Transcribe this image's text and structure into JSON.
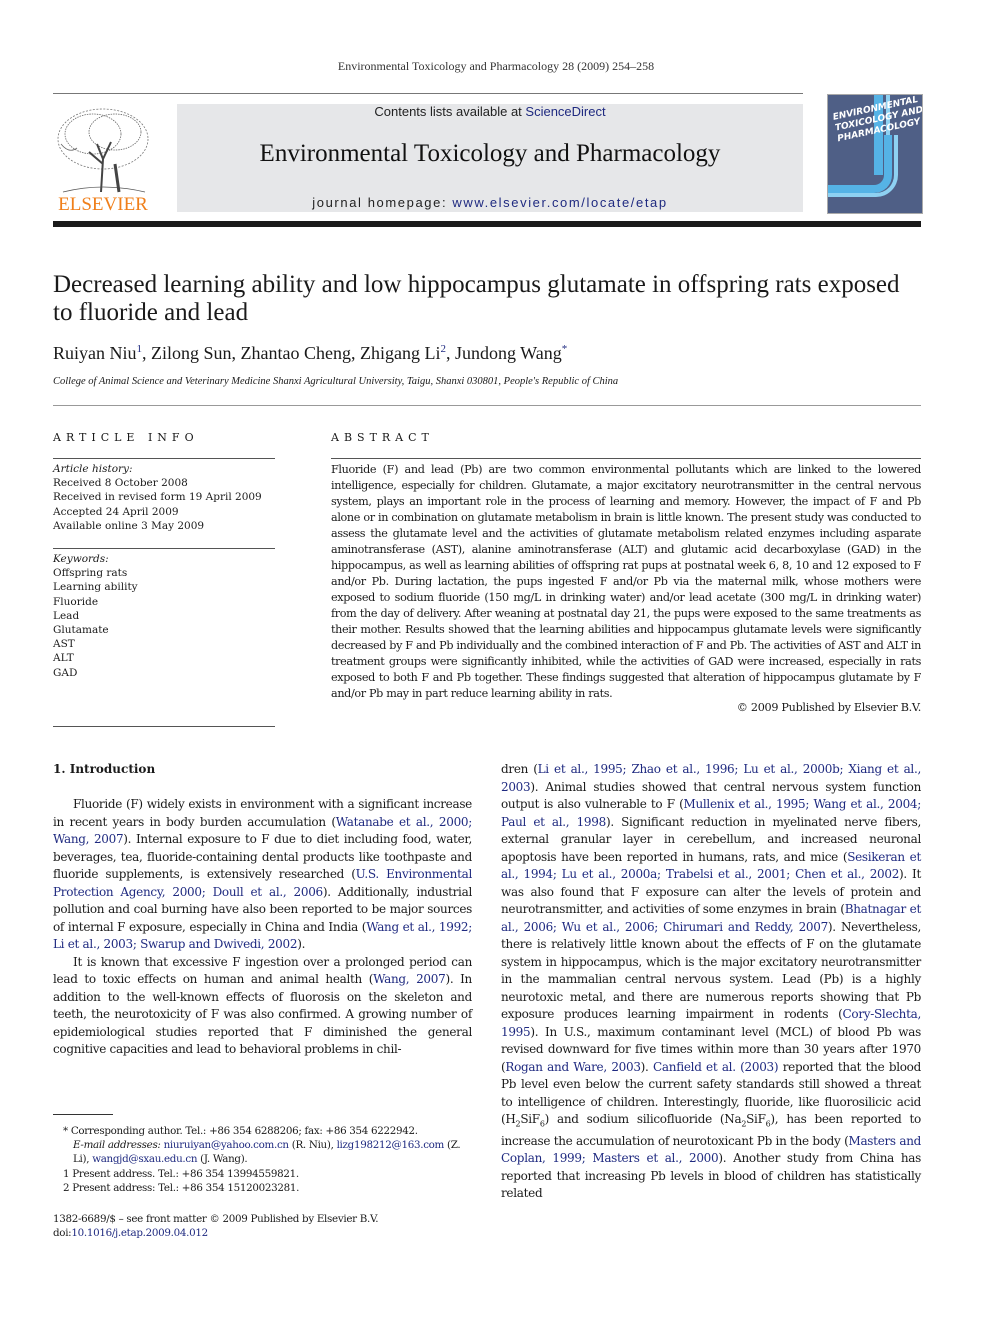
{
  "running_head": "Environmental Toxicology and Pharmacology 28 (2009) 254–258",
  "masthead": {
    "publisher_logo_text": "ELSEVIER",
    "contents_prefix": "Contents lists available at ",
    "contents_link": "ScienceDirect",
    "journal_title": "Environmental Toxicology and Pharmacology",
    "homepage_prefix": "journal homepage: ",
    "homepage_link": "www.elsevier.com/locate/etap",
    "cover_text": "ENVIRONMENTAL TOXICOLOGY AND PHARMACOLOGY",
    "colors": {
      "elsevier_orange": "#f07f1a",
      "link_blue": "#1f2a80",
      "banner_gray": "#e6e7e9",
      "cover_blue": "#4f5f86"
    }
  },
  "article": {
    "title": "Decreased learning ability and low hippocampus glutamate in offspring rats exposed to fluoride and lead",
    "authors": [
      {
        "name": "Ruiyan Niu",
        "mark": "1"
      },
      {
        "name": "Zilong Sun",
        "mark": ""
      },
      {
        "name": "Zhantao Cheng",
        "mark": ""
      },
      {
        "name": "Zhigang Li",
        "mark": "2"
      },
      {
        "name": "Jundong Wang",
        "mark": "*"
      }
    ],
    "affiliation": "College of Animal Science and Veterinary Medicine Shanxi Agricultural University, Taigu, Shanxi 030801, People's Republic of China"
  },
  "article_info": {
    "heading": "ARTICLE INFO",
    "history_label": "Article history:",
    "history": [
      "Received 8 October 2008",
      "Received in revised form 19 April 2009",
      "Accepted 24 April 2009",
      "Available online 3 May 2009"
    ],
    "keywords_label": "Keywords:",
    "keywords": [
      "Offspring rats",
      "Learning ability",
      "Fluoride",
      "Lead",
      "Glutamate",
      "AST",
      "ALT",
      "GAD"
    ]
  },
  "abstract": {
    "heading": "ABSTRACT",
    "text": "Fluoride (F) and lead (Pb) are two common environmental pollutants which are linked to the lowered intelligence, especially for children. Glutamate, a major excitatory neurotransmitter in the central nervous system, plays an important role in the process of learning and memory. However, the impact of F and Pb alone or in combination on glutamate metabolism in brain is little known. The present study was conducted to assess the glutamate level and the activities of glutamate metabolism related enzymes including asparate aminotransferase (AST), alanine aminotransferase (ALT) and glutamic acid decarboxylase (GAD) in the hippocampus, as well as learning abilities of offspring rat pups at postnatal week 6, 8, 10 and 12 exposed to F and/or Pb. During lactation, the pups ingested F and/or Pb via the maternal milk, whose mothers were exposed to sodium fluoride (150 mg/L in drinking water) and/or lead acetate (300 mg/L in drinking water) from the day of delivery. After weaning at postnatal day 21, the pups were exposed to the same treatments as their mother. Results showed that the learning abilities and hippocampus glutamate levels were significantly decreased by F and Pb individually and the combined interaction of F and Pb. The activities of AST and ALT in treatment groups were significantly inhibited, while the activities of GAD were increased, especially in rats exposed to both F and Pb together. These findings suggested that alteration of hippocampus glutamate by F and/or Pb may in part reduce learning ability in rats.",
    "copyright": "© 2009 Published by Elsevier B.V."
  },
  "introduction": {
    "heading": "1.  Introduction",
    "left_paragraphs": [
      [
        {
          "t": "Fluoride (F) widely exists in environment with a significant increase in recent years in body burden accumulation ("
        },
        {
          "l": "Watanabe et al., 2000; Wang, 2007"
        },
        {
          "t": "). Internal exposure to F due to diet including food, water, beverages, tea, fluoride-containing dental products like toothpaste and fluoride supplements, is extensively researched ("
        },
        {
          "l": "U.S. Environmental Protection Agency, 2000; Doull et al., 2006"
        },
        {
          "t": "). Additionally, industrial pollution and coal burning have also been reported to be major sources of internal F exposure, especially in China and India ("
        },
        {
          "l": "Wang et al., 1992; Li et al., 2003; Swarup and Dwivedi, 2002"
        },
        {
          "t": ")."
        }
      ],
      [
        {
          "t": "It is known that excessive F ingestion over a prolonged period can lead to toxic effects on human and animal health ("
        },
        {
          "l": "Wang, 2007"
        },
        {
          "t": "). In addition to the well-known effects of fluorosis on the skeleton and teeth, the neurotoxicity of F was also confirmed. A growing number of epidemiological studies reported that F diminished the general cognitive capacities and lead to behavioral problems in chil-"
        }
      ]
    ],
    "right_paragraphs": [
      [
        {
          "t": "dren ("
        },
        {
          "l": "Li et al., 1995; Zhao et al., 1996; Lu et al., 2000b; Xiang et al., 2003"
        },
        {
          "t": "). Animal studies showed that central nervous system function output is also vulnerable to F ("
        },
        {
          "l": "Mullenix et al., 1995; Wang et al., 2004; Paul et al., 1998"
        },
        {
          "t": "). Significant reduction in myelinated nerve fibers, external granular layer in cerebellum, and increased neuronal apoptosis have been reported in humans, rats, and mice ("
        },
        {
          "l": "Sesikeran et al., 1994; Lu et al., 2000a; Trabelsi et al., 2001; Chen et al., 2002"
        },
        {
          "t": "). It was also found that F exposure can alter the levels of protein and neurotransmitter, and activities of some enzymes in brain ("
        },
        {
          "l": "Bhatnagar et al., 2006; Wu et al., 2006; Chirumari and Reddy, 2007"
        },
        {
          "t": "). Nevertheless, there is relatively little known about the effects of F on the glutamate system in hippocampus, which is the major excitatory neurotransmitter in the mammalian central nervous system. Lead (Pb) is a highly neurotoxic metal, and there are numerous reports showing that Pb exposure produces learning impairment in rodents ("
        },
        {
          "l": "Cory-Slechta, 1995"
        },
        {
          "t": "). In U.S., maximum contaminant level (MCL) of blood Pb was revised downward for five times within more than 30 years after 1970 ("
        },
        {
          "l": "Rogan and Ware, 2003"
        },
        {
          "t": "). "
        },
        {
          "l": "Canfield et al. (2003)"
        },
        {
          "t": " reported that the blood Pb level even below the current safety standards still showed a threat to intelligence of children. Interestingly, fluoride, like fluorosilicic acid (H"
        },
        {
          "s": "2"
        },
        {
          "t": "SiF"
        },
        {
          "s": "6"
        },
        {
          "t": ") and sodium silicofluoride (Na"
        },
        {
          "s": "2"
        },
        {
          "t": "SiF"
        },
        {
          "s": "6"
        },
        {
          "t": "), has been reported to increase the accumulation of neurotoxicant Pb in the body ("
        },
        {
          "l": "Masters and Coplan, 1999; Masters et al., 2000"
        },
        {
          "t": "). Another study from China has reported that increasing Pb levels in blood of children has statistically related"
        }
      ]
    ]
  },
  "footnotes": {
    "corresponding": "*  Corresponding author. Tel.: +86 354 6288206; fax: +86 354 6222942.",
    "email_label": "E-mail addresses:",
    "emails": [
      {
        "address": "niuruiyan@yahoo.com.cn",
        "who": " (R. Niu), "
      },
      {
        "address": "lizg198212@163.com",
        "who": " (Z. Li), "
      },
      {
        "address": "wangjd@sxau.edu.cn",
        "who": " (J. Wang)."
      }
    ],
    "note1": "1  Present address. Tel.: +86 354 13994559821.",
    "note2": "2  Present address: Tel.: +86 354 15120023281."
  },
  "front_matter": {
    "issn_line": "1382-6689/$ – see front matter © 2009 Published by Elsevier B.V.",
    "doi_prefix": "doi:",
    "doi": "10.1016/j.etap.2009.04.012"
  }
}
